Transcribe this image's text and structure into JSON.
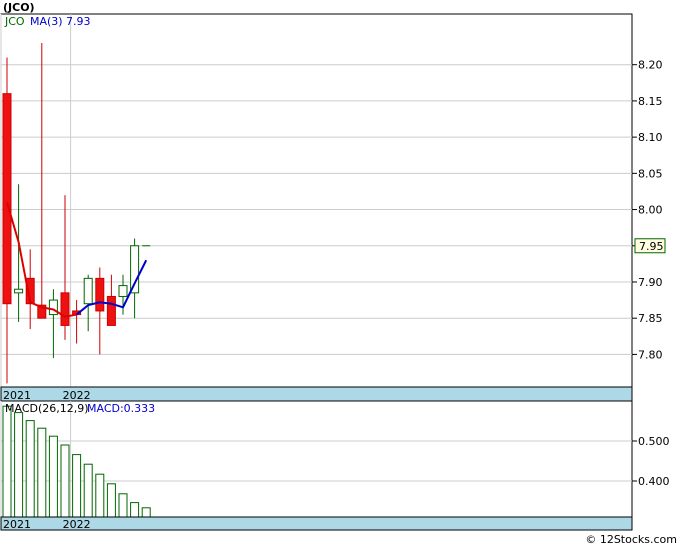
{
  "title": "(JCO)",
  "footer": "© 12Stocks.com",
  "chart_data": [
    {
      "type": "candlestick",
      "legend": {
        "symbol": "JCO",
        "ma_label": "MA(3)",
        "ma_value": "7.93"
      },
      "ylim": [
        7.755,
        8.27
      ],
      "yticks": [
        "8.20",
        "8.15",
        "8.10",
        "8.05",
        "8.00",
        "7.95",
        "7.90",
        "7.85",
        "7.80"
      ],
      "last_price_label": "7.95",
      "x_labels": [
        {
          "label": "2021",
          "index": 0
        },
        {
          "label": "2022",
          "index": 6
        }
      ],
      "grid": true,
      "series": [
        {
          "name": "candles",
          "candles": [
            {
              "open": 8.16,
              "high": 8.21,
              "low": 7.76,
              "close": 7.87
            },
            {
              "open": 7.885,
              "high": 8.035,
              "low": 7.845,
              "close": 7.89
            },
            {
              "open": 7.905,
              "high": 7.945,
              "low": 7.835,
              "close": 7.87
            },
            {
              "open": 7.868,
              "high": 8.23,
              "low": 7.85,
              "close": 7.85
            },
            {
              "open": 7.855,
              "high": 7.89,
              "low": 7.795,
              "close": 7.875
            },
            {
              "open": 7.885,
              "high": 8.02,
              "low": 7.82,
              "close": 7.84
            },
            {
              "open": 7.86,
              "high": 7.875,
              "low": 7.815,
              "close": 7.855
            },
            {
              "open": 7.87,
              "high": 7.91,
              "low": 7.832,
              "close": 7.905
            },
            {
              "open": 7.905,
              "high": 7.92,
              "low": 7.8,
              "close": 7.86
            },
            {
              "open": 7.88,
              "high": 7.91,
              "low": 7.84,
              "close": 7.84
            },
            {
              "open": 7.88,
              "high": 7.91,
              "low": 7.855,
              "close": 7.895
            },
            {
              "open": 7.885,
              "high": 7.96,
              "low": 7.85,
              "close": 7.95
            },
            {
              "open": 7.95,
              "high": 7.95,
              "low": 7.95,
              "close": 7.95
            }
          ]
        },
        {
          "name": "MA(3)",
          "color": "#0000cc",
          "values": [
            {
              "i": 0,
              "v": 8.01
            },
            {
              "i": 1,
              "v": 7.955
            },
            {
              "i": 2,
              "v": 7.872
            },
            {
              "i": 3,
              "v": 7.865
            },
            {
              "i": 4,
              "v": 7.862
            },
            {
              "i": 5,
              "v": 7.852
            },
            {
              "i": 6,
              "v": 7.855
            },
            {
              "i": 7,
              "v": 7.868
            },
            {
              "i": 8,
              "v": 7.872
            },
            {
              "i": 9,
              "v": 7.87
            },
            {
              "i": 10,
              "v": 7.865
            },
            {
              "i": 11,
              "v": 7.898
            },
            {
              "i": 12,
              "v": 7.93
            }
          ]
        }
      ]
    },
    {
      "type": "bar",
      "legend": {
        "label": "MACD(26,12,9)",
        "value_label": "MACD:0.333"
      },
      "ylim": [
        0.31,
        0.6
      ],
      "yticks": [
        "0.500",
        "0.400"
      ],
      "x_labels": [
        {
          "label": "2021",
          "index": 0
        },
        {
          "label": "2022",
          "index": 6
        }
      ],
      "grid": true,
      "values": [
        0.587,
        0.571,
        0.551,
        0.532,
        0.512,
        0.49,
        0.466,
        0.442,
        0.417,
        0.393,
        0.368,
        0.346,
        0.333
      ]
    }
  ]
}
